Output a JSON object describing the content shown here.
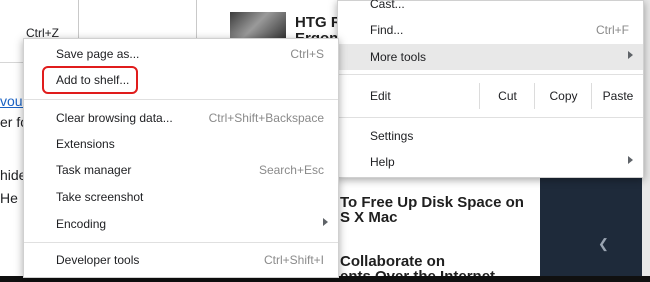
{
  "background": {
    "keyboard_hint": "Ctrl+Z",
    "left_text_lines": [
      "vour",
      "er fo",
      "hide",
      "He"
    ],
    "article1_title_line1": "HTG Re",
    "article1_title_line2": "Ergone",
    "article2_title_line1": "To Free Up Disk Space on",
    "article2_title_line2": "S X Mac",
    "article3_title_line1": "Collaborate on",
    "article3_title_line2": "ents Over the Internet"
  },
  "main_menu": {
    "cast": "Cast...",
    "find": "Find...",
    "find_shortcut": "Ctrl+F",
    "more_tools": "More tools",
    "edit": "Edit",
    "cut": "Cut",
    "copy": "Copy",
    "paste": "Paste",
    "settings": "Settings",
    "help": "Help"
  },
  "submenu": {
    "items": [
      {
        "label": "Save page as...",
        "shortcut": "Ctrl+S"
      },
      {
        "label": "Add to shelf...",
        "shortcut": ""
      },
      {
        "label": "Clear browsing data...",
        "shortcut": "Ctrl+Shift+Backspace"
      },
      {
        "label": "Extensions",
        "shortcut": ""
      },
      {
        "label": "Task manager",
        "shortcut": "Search+Esc"
      },
      {
        "label": "Take screenshot",
        "shortcut": ""
      },
      {
        "label": "Encoding",
        "shortcut": ""
      },
      {
        "label": "Developer tools",
        "shortcut": "Ctrl+Shift+I"
      }
    ]
  },
  "colors": {
    "highlight_outline": "#e01c1c",
    "hover_row": "#e8e8e8",
    "dark_panel": "#1e2a3a"
  }
}
